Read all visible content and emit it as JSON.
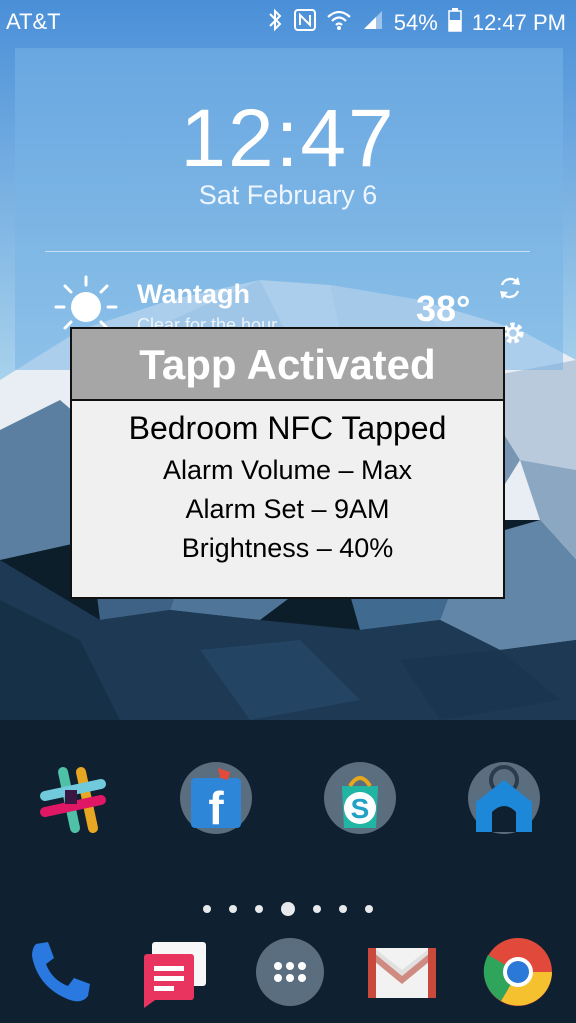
{
  "status_bar": {
    "carrier": "AT&T",
    "battery": "54%",
    "time": "12:47 PM"
  },
  "clock_widget": {
    "time": "12:47",
    "date": "Sat February 6"
  },
  "weather": {
    "location": "Wantagh",
    "condition": "Clear for the hour",
    "temperature": "38°"
  },
  "popup": {
    "title": "Tapp Activated",
    "line1": "Bedroom NFC Tapped",
    "line2": "Alarm Volume – Max",
    "line3": "Alarm Set – 9AM",
    "line4": "Brightness – 40%"
  },
  "home_apps": [
    "slack-icon",
    "facebook-icon",
    "skype-icon",
    "home-icon"
  ],
  "dock_apps": [
    "phone-icon",
    "messages-icon",
    "app-drawer-icon",
    "gmail-icon",
    "chrome-icon"
  ],
  "page_indicator": {
    "pages": 7,
    "active_page": 4
  }
}
